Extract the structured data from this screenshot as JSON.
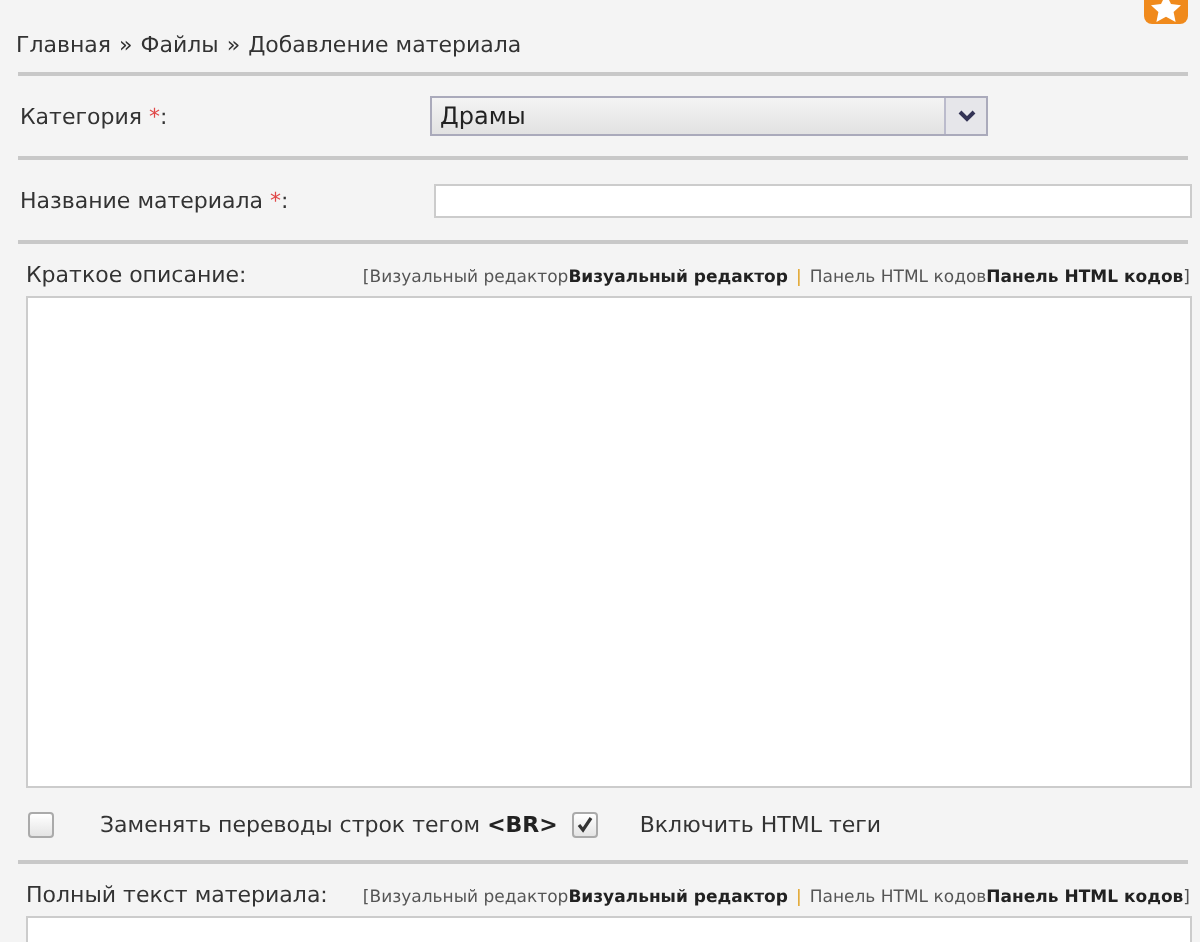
{
  "breadcrumb": [
    "Главная",
    "Файлы",
    "Добавление материала"
  ],
  "breadcrumb_separator": "»",
  "category": {
    "label": "Категория",
    "required_mark": "*",
    "suffix": ":",
    "value": "Драмы"
  },
  "title_field": {
    "label": "Название материала",
    "required_mark": "*",
    "suffix": ":"
  },
  "short_description": {
    "label": "Краткое описание:",
    "switch": {
      "open": "[",
      "options": [
        {
          "link": "Визуальный редактор",
          "label": "Визуальный редактор"
        },
        {
          "link": "Панель HTML кодов",
          "label": "Панель HTML кодов"
        }
      ],
      "separator": "|",
      "close": "]"
    }
  },
  "options": [
    {
      "label": "Заменять переводы строк тегом **<BR>**",
      "checked": false
    },
    {
      "label": "Включить HTML теги",
      "checked": true
    }
  ],
  "full_text": {
    "label": "Полный текст материала:",
    "switch": {
      "open": "[",
      "options": [
        {
          "link": "Визуальный редактор",
          "label": "Визуальный редактор"
        },
        {
          "link": "Панель HTML кодов",
          "label": "Панель HTML кодов"
        }
      ],
      "separator": "|",
      "close": "]"
    }
  }
}
